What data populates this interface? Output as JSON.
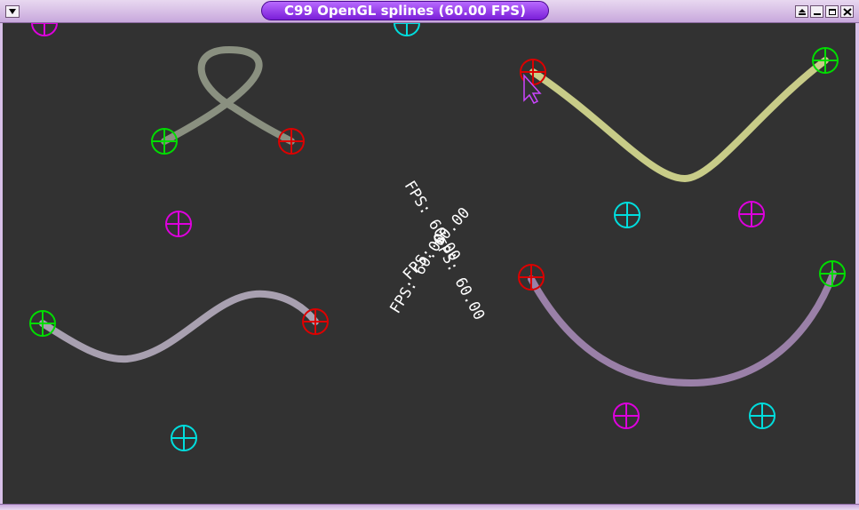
{
  "window": {
    "title": "C99 OpenGL splines (60.00 FPS)"
  },
  "titlebar_buttons": [
    "menu-icon",
    "shade-icon",
    "minimize-icon",
    "maximize-icon",
    "close-icon"
  ],
  "canvas": {
    "background": "#323232",
    "fps_labels": [
      "FPS: 60.00",
      "FPS: 60.00",
      "FPS: 60.00",
      "FPS: 60.00"
    ]
  },
  "colors": {
    "start_marker": "#00dd00",
    "end_marker": "#dd0000",
    "control_marker_a": "#dd00dd",
    "control_marker_b": "#00dddd",
    "title_pill": "#8a2be2",
    "text": "#ffffff"
  },
  "splines": [
    {
      "name": "spline-loop",
      "color": "#8a9080"
    },
    {
      "name": "spline-v",
      "color": "#c8cc88"
    },
    {
      "name": "spline-wave",
      "color": "#a8a0b0"
    },
    {
      "name": "spline-bowl",
      "color": "#9a80a8"
    }
  ]
}
